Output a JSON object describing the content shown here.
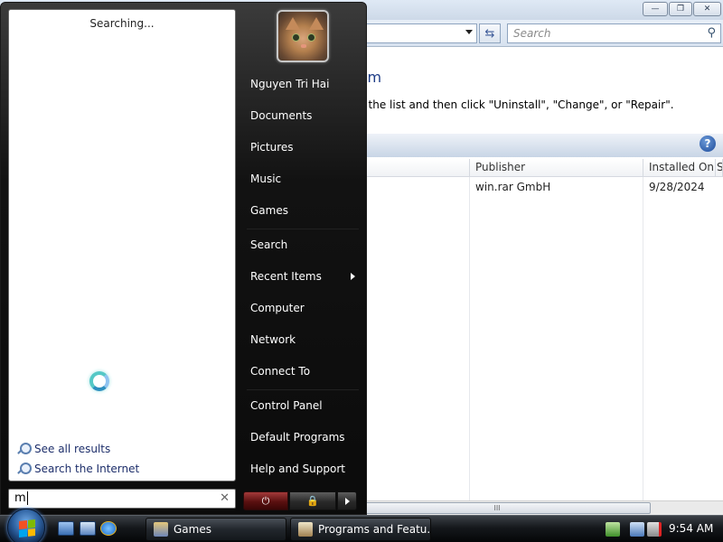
{
  "background_window": {
    "title_buttons": {
      "minimize": "—",
      "maximize": "❐",
      "close": "✕"
    },
    "search_placeholder": "Search",
    "heading_fragment": "gram",
    "instruction_fragment": "rom the list and then click \"Uninstall\", \"Change\", or \"Repair\".",
    "columns": [
      "Publisher",
      "Installed On",
      "S"
    ],
    "rows": [
      {
        "publisher": "win.rar GmbH",
        "installed_on": "9/28/2024"
      }
    ],
    "scroll_grip": "III"
  },
  "start_menu": {
    "search_status": "Searching...",
    "see_all_results": "See all results",
    "search_internet": "Search the Internet",
    "search_text": "m",
    "clear_symbol": "✕",
    "user_name": "Nguyen Tri Hai",
    "places": [
      {
        "id": "documents",
        "label": "Documents"
      },
      {
        "id": "pictures",
        "label": "Pictures"
      },
      {
        "id": "music",
        "label": "Music"
      },
      {
        "id": "games",
        "label": "Games"
      },
      {
        "id": "search",
        "label": "Search"
      },
      {
        "id": "recent-items",
        "label": "Recent Items"
      },
      {
        "id": "computer",
        "label": "Computer"
      },
      {
        "id": "network",
        "label": "Network"
      },
      {
        "id": "connect-to",
        "label": "Connect To"
      },
      {
        "id": "control-panel",
        "label": "Control Panel"
      },
      {
        "id": "default-programs",
        "label": "Default Programs"
      },
      {
        "id": "help-and-support",
        "label": "Help and Support"
      }
    ],
    "power_symbol": "⏻",
    "lock_symbol": "🔒"
  },
  "taskbar": {
    "buttons": [
      {
        "label": "Games"
      },
      {
        "label": "Programs and Featu..."
      }
    ],
    "clock": "9:54 AM"
  },
  "colors": {
    "accent": "#1e3c87",
    "orb": "#2c5f9e",
    "power_red": "#a33a3a"
  }
}
